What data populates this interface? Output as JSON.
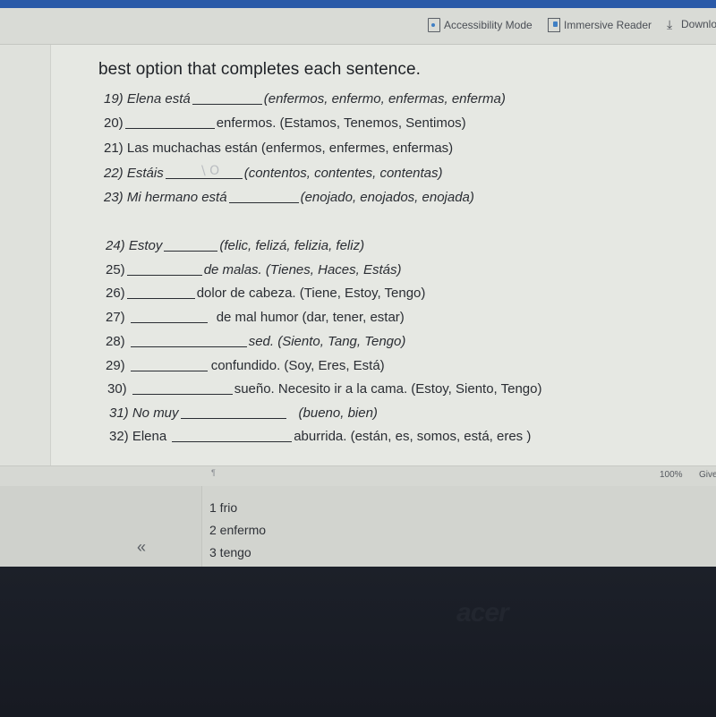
{
  "toolbar": {
    "accessibility_mode": "Accessibility Mode",
    "immersive_reader": "Immersive Reader",
    "download": "Downlo"
  },
  "document": {
    "heading": "best option that completes each sentence.",
    "questions": [
      {
        "num": "19) Elena está",
        "after": "(enfermos, enfermo, enfermas, enferma)"
      },
      {
        "num": "20)",
        "after": "enfermos. (Estamos, Tenemos, Sentimos)"
      },
      {
        "num": "21) Las muchachas están (enfermos, enfermes, enfermas)"
      },
      {
        "num": "22) Estáis",
        "after": "(contentos, contentes, contentas)",
        "handwritten_mark": "\\ O"
      },
      {
        "num": "23) Mi hermano está",
        "after": "(enojado, enojados, enojada)"
      },
      {
        "num": "24) Estoy",
        "after": "(felic, felizá, felizia, feliz)"
      },
      {
        "num": "25)",
        "after": "de malas. (Tienes, Haces, Estás)"
      },
      {
        "num": "26)",
        "after": "dolor de cabeza. (Tiene, Estoy, Tengo)"
      },
      {
        "num": "27)",
        "after": "de mal humor (dar, tener, estar)"
      },
      {
        "num": "28)",
        "after": "sed. (Siento, Tang, Tengo)"
      },
      {
        "num": "29)",
        "after": "confundido. (Soy, Eres, Está)"
      },
      {
        "num": "30)",
        "after": "sueño. Necesito ir a la cama. (Estoy, Siento, Tengo)"
      },
      {
        "num": "31) No muy",
        "after": "(bueno, bien)"
      },
      {
        "num": "32) Elena",
        "after": "aburrida. (están, es, somos, está, eres )"
      }
    ]
  },
  "statusbar": {
    "zoom": "100%",
    "feedback": "Give",
    "pilcrow": "¶"
  },
  "panel": {
    "collapse": "«",
    "items": [
      "1 frio",
      "2 enfermo",
      "3 tengo"
    ]
  },
  "bezel": {
    "brand": "acer"
  },
  "colors": {
    "topbar": "#2a5aa8",
    "accent_icon": "#3f7fc4"
  }
}
